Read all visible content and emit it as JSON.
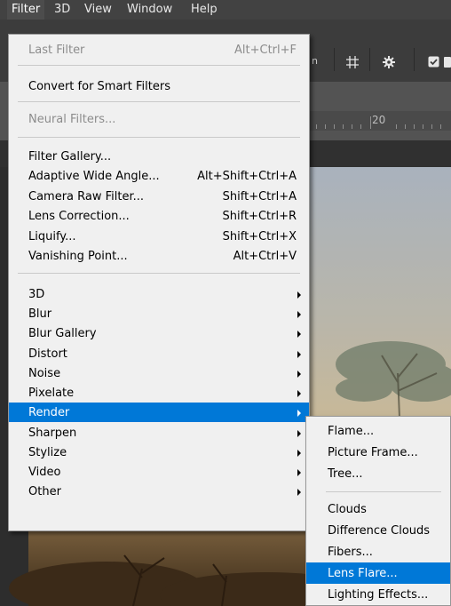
{
  "menubar": {
    "items": [
      {
        "label": "Filter",
        "active": true
      },
      {
        "label": "3D"
      },
      {
        "label": "View"
      },
      {
        "label": "Window"
      },
      {
        "label": "Help"
      }
    ]
  },
  "options_bar": {
    "partial_text": "n",
    "icons": [
      "grid-icon",
      "gear-icon",
      "checkbox-icon"
    ]
  },
  "ruler": {
    "label": "20"
  },
  "filter_menu": {
    "items": [
      {
        "label": "Last Filter",
        "shortcut": "Alt+Ctrl+F",
        "disabled": true
      },
      {
        "label": "Convert for Smart Filters"
      },
      {
        "label": "Neural Filters...",
        "disabled": true
      },
      {
        "label": "Filter Gallery..."
      },
      {
        "label": "Adaptive Wide Angle...",
        "shortcut": "Alt+Shift+Ctrl+A"
      },
      {
        "label": "Camera Raw Filter...",
        "shortcut": "Shift+Ctrl+A"
      },
      {
        "label": "Lens Correction...",
        "shortcut": "Shift+Ctrl+R"
      },
      {
        "label": "Liquify...",
        "shortcut": "Shift+Ctrl+X"
      },
      {
        "label": "Vanishing Point...",
        "shortcut": "Alt+Ctrl+V"
      },
      {
        "label": "3D",
        "submenu": true
      },
      {
        "label": "Blur",
        "submenu": true
      },
      {
        "label": "Blur Gallery",
        "submenu": true
      },
      {
        "label": "Distort",
        "submenu": true
      },
      {
        "label": "Noise",
        "submenu": true
      },
      {
        "label": "Pixelate",
        "submenu": true
      },
      {
        "label": "Render",
        "submenu": true,
        "highlighted": true
      },
      {
        "label": "Sharpen",
        "submenu": true
      },
      {
        "label": "Stylize",
        "submenu": true
      },
      {
        "label": "Video",
        "submenu": true
      },
      {
        "label": "Other",
        "submenu": true
      }
    ]
  },
  "render_submenu": {
    "items": [
      {
        "label": "Flame..."
      },
      {
        "label": "Picture Frame..."
      },
      {
        "label": "Tree..."
      },
      {
        "label": "Clouds"
      },
      {
        "label": "Difference Clouds"
      },
      {
        "label": "Fibers..."
      },
      {
        "label": "Lens Flare...",
        "highlighted": true
      },
      {
        "label": "Lighting Effects..."
      }
    ]
  },
  "colors": {
    "highlight": "#0078d7",
    "menu_bg": "#f0f0f0",
    "menubar_bg": "#424242",
    "disabled_text": "#8c8c8c"
  }
}
